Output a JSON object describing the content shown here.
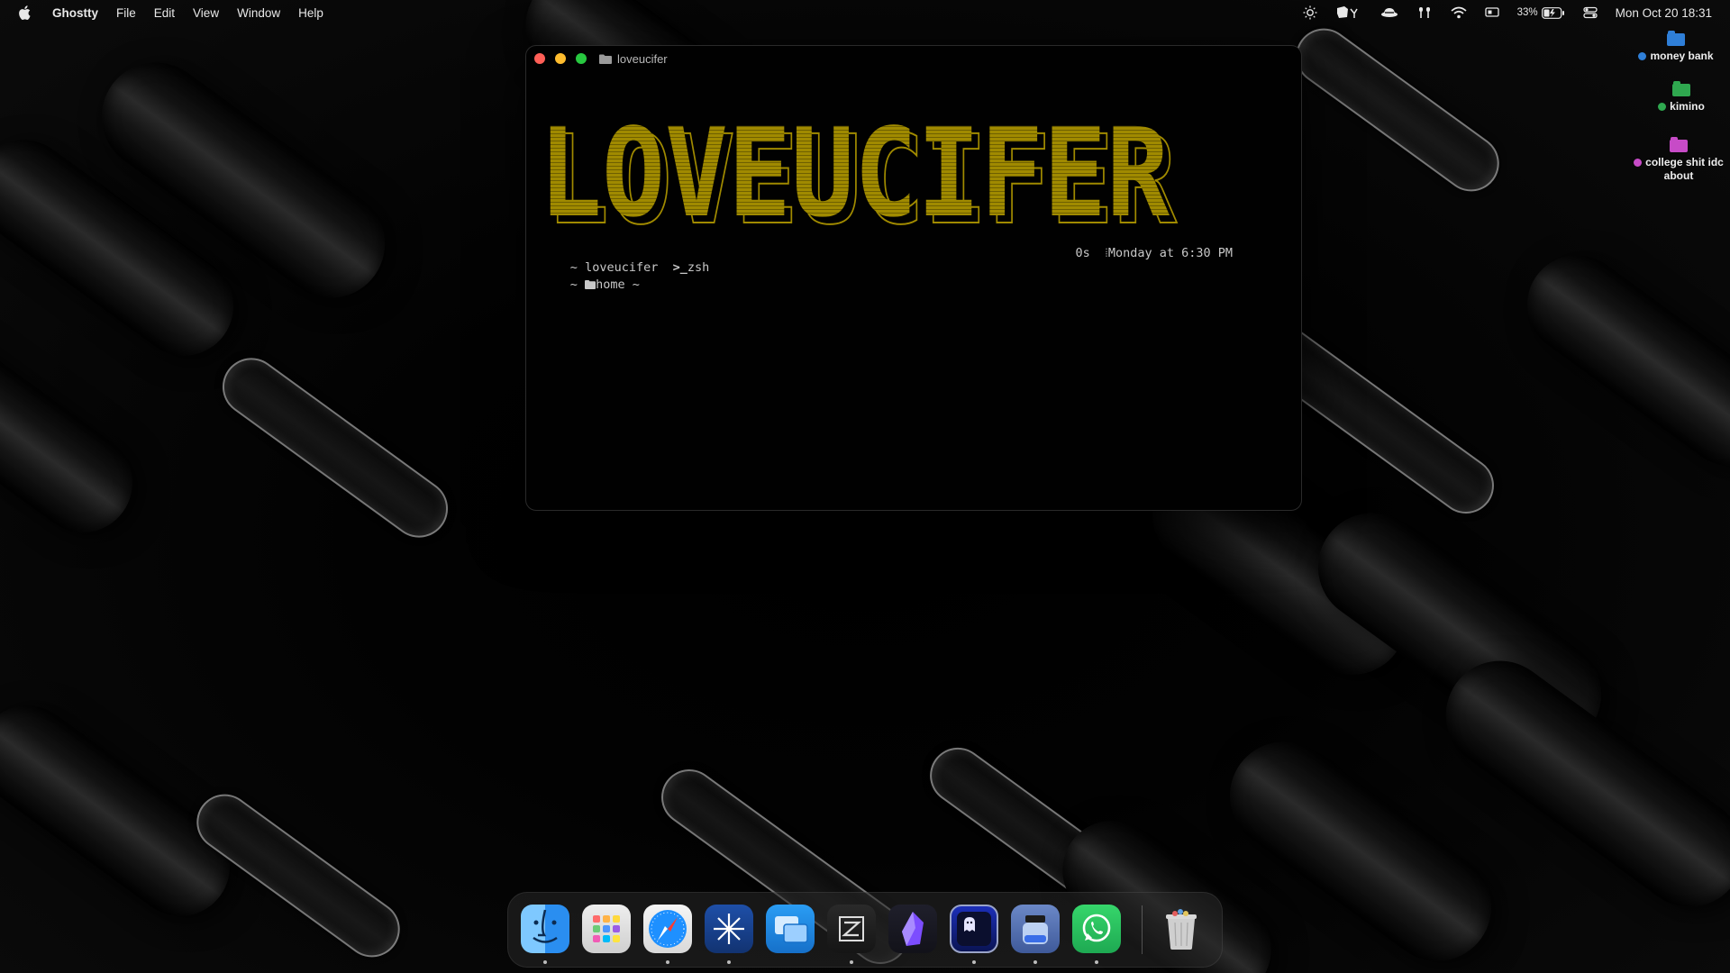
{
  "menubar": {
    "app_name": "Ghostty",
    "menus": [
      "File",
      "Edit",
      "View",
      "Window",
      "Help"
    ],
    "battery_percent": "33%",
    "clock": "Mon Oct 20  18:31"
  },
  "desktop_icons": [
    {
      "label": "money bank",
      "color": "#2f7fd8",
      "tag_color": "#2f7fd8"
    },
    {
      "label": "kimino",
      "color": "#2fa84f",
      "tag_color": "#2fa84f"
    },
    {
      "label": "college shit idc",
      "label2": "about",
      "color": "#c74bc7",
      "tag_color": "#c74bc7"
    }
  ],
  "terminal": {
    "title": "loveucifer",
    "banner_text": "LOVEUCIFER",
    "banner_color": "#a08a00",
    "prompt_line": {
      "tilde": "~",
      "user": "loveucifer",
      "shell": "zsh",
      "duration": "0s",
      "timestamp": "Monday at 6:30 PM"
    },
    "path_line": {
      "tilde": "~",
      "dir": "home",
      "suffix": "~"
    }
  },
  "dock": {
    "apps": [
      {
        "name": "Finder",
        "icon": "finder-icon",
        "running": true
      },
      {
        "name": "Launchpad",
        "icon": "launchpad-icon",
        "running": false
      },
      {
        "name": "Safari",
        "icon": "safari-icon",
        "running": true
      },
      {
        "name": "Perplexity",
        "icon": "asterisk-app-icon",
        "running": true
      },
      {
        "name": "Microsoft Remote Desktop",
        "icon": "remote-desktop-icon",
        "running": false
      },
      {
        "name": "Zed",
        "icon": "zed-icon",
        "running": true
      },
      {
        "name": "Obsidian",
        "icon": "obsidian-icon",
        "running": false
      },
      {
        "name": "Ghostty",
        "icon": "ghostty-icon",
        "running": true
      },
      {
        "name": "App",
        "icon": "jar-app-icon",
        "running": true
      },
      {
        "name": "WhatsApp",
        "icon": "whatsapp-icon",
        "running": true
      }
    ],
    "trash": {
      "name": "Trash",
      "icon": "trash-icon"
    }
  }
}
